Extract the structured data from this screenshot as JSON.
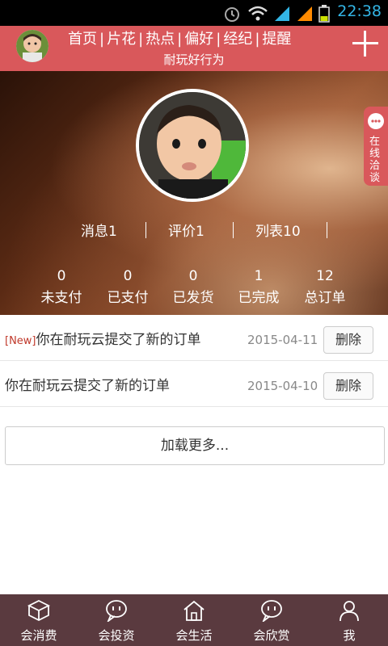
{
  "status_bar": {
    "time": "22:38"
  },
  "header": {
    "nav": [
      "首页",
      "片花",
      "热点",
      "偏好",
      "经纪",
      "提醒"
    ],
    "separator": "|",
    "subtitle": "耐玩好行为"
  },
  "profile": {
    "stats": [
      {
        "label": "消息1"
      },
      {
        "label": "评价1"
      },
      {
        "label": "列表10"
      }
    ],
    "order_counts": [
      {
        "value": "0",
        "label": "未支付"
      },
      {
        "value": "0",
        "label": "已支付"
      },
      {
        "value": "0",
        "label": "已发货"
      },
      {
        "value": "1",
        "label": "已完成"
      },
      {
        "value": "12",
        "label": "总订单"
      }
    ]
  },
  "chat_tab": {
    "label": "在线洽谈"
  },
  "messages": [
    {
      "tag": "[New]",
      "text": "你在耐玩云提交了新的订单",
      "date": "2015-04-11",
      "action": "删除"
    },
    {
      "tag": "",
      "text": "你在耐玩云提交了新的订单",
      "date": "2015-04-10",
      "action": "删除"
    }
  ],
  "load_more": "加载更多...",
  "bottom_tabs": [
    {
      "label": "会消费",
      "icon": "cube-icon"
    },
    {
      "label": "会投资",
      "icon": "chat-bubble-icon"
    },
    {
      "label": "会生活",
      "icon": "house-icon"
    },
    {
      "label": "会欣赏",
      "icon": "chat-bubble-icon"
    },
    {
      "label": "我",
      "icon": "person-icon"
    }
  ],
  "colors": {
    "accent": "#d9585b",
    "bottom_bar": "#5a3a3f",
    "status_time": "#33b5e5"
  }
}
